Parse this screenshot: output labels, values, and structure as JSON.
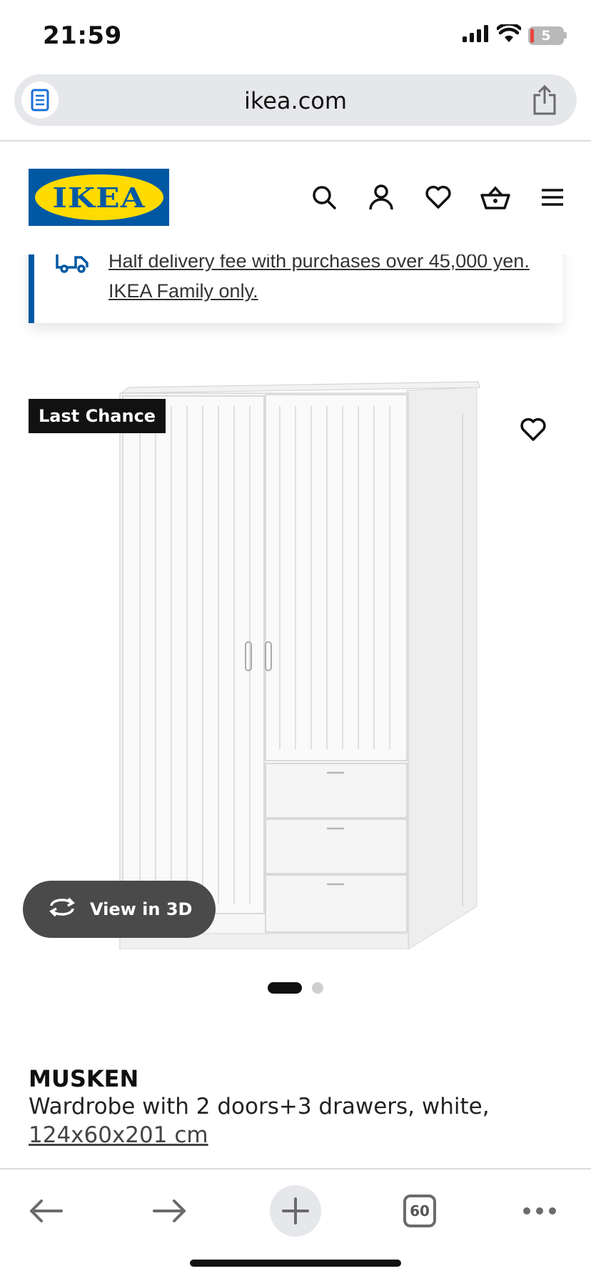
{
  "status_bar": {
    "time": "21:59",
    "battery_level": "5",
    "icons": [
      "signal-icon",
      "wifi-icon",
      "battery-icon"
    ]
  },
  "browser": {
    "url": "ikea.com",
    "reader_icon": "reader-mode-icon",
    "share_icon": "share-icon"
  },
  "header": {
    "logo_text": "IKEA",
    "icons": [
      "search-icon",
      "account-icon",
      "wishlist-icon",
      "cart-icon",
      "menu-icon"
    ]
  },
  "banner": {
    "text": "Half delivery fee with purchases over 45,000 yen. IKEA Family only.",
    "icon": "delivery-truck-icon"
  },
  "product": {
    "badge": "Last Chance",
    "view_3d_label": "View in 3D",
    "name": "MUSKEN",
    "description": "Wardrobe with 2 doors+3 drawers, white,",
    "size": "124x60x201 cm",
    "image_count": 2,
    "active_image": 1
  },
  "toolbar": {
    "tabs_count": "60",
    "icons": [
      "back-arrow-icon",
      "forward-arrow-icon",
      "new-tab-plus-icon",
      "tabs-icon",
      "more-icon"
    ]
  },
  "colors": {
    "ikea_blue": "#0058a3",
    "ikea_yellow": "#ffdb00",
    "badge_bg": "#111111",
    "view3d_bg": "#4a4a4a"
  }
}
